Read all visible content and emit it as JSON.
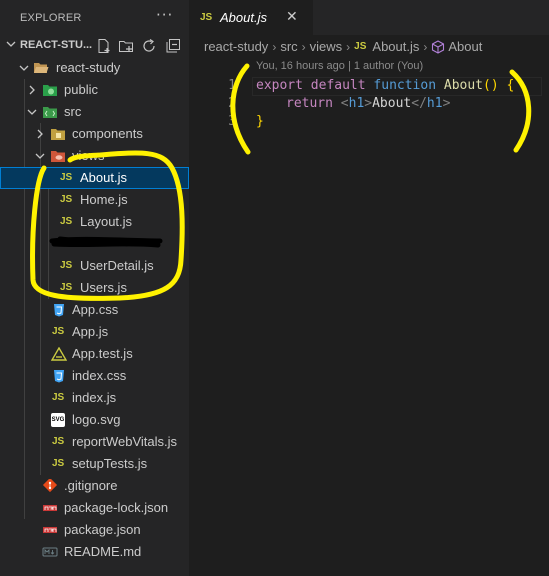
{
  "explorer": {
    "title": "EXPLORER",
    "more_label": "···",
    "section_title": "REACT-STU...",
    "tree": [
      {
        "label": "react-study"
      },
      {
        "label": "public"
      },
      {
        "label": "src"
      },
      {
        "label": "components"
      },
      {
        "label": "views"
      },
      {
        "label": "About.js"
      },
      {
        "label": "Home.js"
      },
      {
        "label": "Layout.js"
      },
      {
        "label": ""
      },
      {
        "label": "UserDetail.js"
      },
      {
        "label": "Users.js"
      },
      {
        "label": "App.css"
      },
      {
        "label": "App.js"
      },
      {
        "label": "App.test.js"
      },
      {
        "label": "index.css"
      },
      {
        "label": "index.js"
      },
      {
        "label": "logo.svg"
      },
      {
        "label": "reportWebVitals.js"
      },
      {
        "label": "setupTests.js"
      },
      {
        "label": ".gitignore"
      },
      {
        "label": "package-lock.json"
      },
      {
        "label": "package.json"
      },
      {
        "label": "README.md"
      }
    ]
  },
  "icons": {
    "js": "JS",
    "svg": "SVG"
  },
  "editor": {
    "tab": {
      "label": "About.js",
      "close": "✕"
    },
    "breadcrumbs": [
      "react-study",
      "src",
      "views",
      "About.js",
      "About"
    ],
    "blame": "You, 16 hours ago | 1 author (You)",
    "line_numbers": [
      "1",
      "2",
      "3"
    ],
    "code": {
      "line1": {
        "export": "export",
        "default": "default",
        "function": "function",
        "name": "About",
        "parens": "()",
        "brace": "{"
      },
      "line2": {
        "return": "return",
        "open_tag_lt": "<",
        "open_tag": "h1",
        "open_tag_gt": ">",
        "text": "About",
        "close_tag_lt": "</",
        "close_tag": "h1",
        "close_tag_gt": ">"
      },
      "line3": {
        "brace": "}"
      }
    }
  },
  "colors": {
    "accent": "#007fd4",
    "selection": "#04395e",
    "js_icon": "#cbcb41",
    "highlighter": "#fff200"
  }
}
